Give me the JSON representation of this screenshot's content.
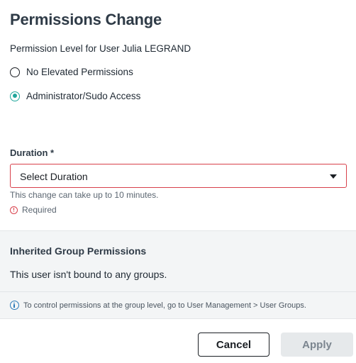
{
  "dialog": {
    "title": "Permissions Change",
    "subtitle": "Permission Level for User Julia LEGRAND"
  },
  "permission_options": [
    {
      "label": "No Elevated Permissions",
      "selected": false
    },
    {
      "label": "Administrator/Sudo Access",
      "selected": true
    }
  ],
  "duration": {
    "label": "Duration *",
    "value": "Select Duration",
    "helper": "This change can take up to 10 minutes.",
    "error": "Required"
  },
  "group_permissions": {
    "title": "Inherited Group Permissions",
    "text": "This user isn't bound to any groups.",
    "info": "To control permissions at the group level, go to User Management > User Groups."
  },
  "footer": {
    "cancel_label": "Cancel",
    "apply_label": "Apply"
  },
  "colors": {
    "accent": "#1fa69b",
    "error": "#d8404b",
    "info": "#2a7ab8"
  }
}
